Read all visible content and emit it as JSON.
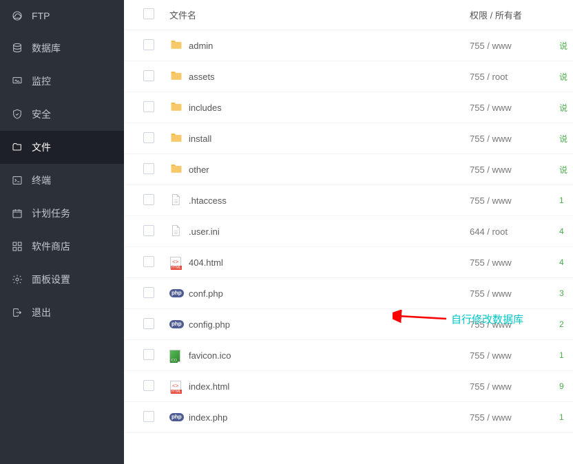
{
  "sidebar": {
    "items": [
      {
        "label": "FTP",
        "icon": "cloud-icon"
      },
      {
        "label": "数据库",
        "icon": "database-icon"
      },
      {
        "label": "监控",
        "icon": "monitor-icon"
      },
      {
        "label": "安全",
        "icon": "shield-icon"
      },
      {
        "label": "文件",
        "icon": "folder-open-icon",
        "active": true
      },
      {
        "label": "终端",
        "icon": "terminal-icon"
      },
      {
        "label": "计划任务",
        "icon": "calendar-icon"
      },
      {
        "label": "软件商店",
        "icon": "grid-icon"
      },
      {
        "label": "面板设置",
        "icon": "gear-icon"
      },
      {
        "label": "退出",
        "icon": "logout-icon"
      }
    ]
  },
  "table": {
    "headers": {
      "filename": "文件名",
      "permission": "权限 / 所有者"
    },
    "files": [
      {
        "name": "admin",
        "type": "folder",
        "perm": "755 / www",
        "extra": "说"
      },
      {
        "name": "assets",
        "type": "folder",
        "perm": "755 / root",
        "extra": "说"
      },
      {
        "name": "includes",
        "type": "folder",
        "perm": "755 / www",
        "extra": "说"
      },
      {
        "name": "install",
        "type": "folder",
        "perm": "755 / www",
        "extra": "说"
      },
      {
        "name": "other",
        "type": "folder",
        "perm": "755 / www",
        "extra": "说"
      },
      {
        "name": ".htaccess",
        "type": "file",
        "perm": "755 / www",
        "extra": "1"
      },
      {
        "name": ".user.ini",
        "type": "file",
        "perm": "644 / root",
        "extra": "4"
      },
      {
        "name": "404.html",
        "type": "html",
        "perm": "755 / www",
        "extra": "4"
      },
      {
        "name": "conf.php",
        "type": "php",
        "perm": "755 / www",
        "extra": "3"
      },
      {
        "name": "config.php",
        "type": "php",
        "perm": "755 / www",
        "extra": "2"
      },
      {
        "name": "favicon.ico",
        "type": "ico",
        "perm": "755 / www",
        "extra": "1"
      },
      {
        "name": "index.html",
        "type": "html",
        "perm": "755 / www",
        "extra": "9"
      },
      {
        "name": "index.php",
        "type": "php",
        "perm": "755 / www",
        "extra": "1"
      }
    ]
  },
  "annotation": {
    "text": "自行修改数据库"
  }
}
